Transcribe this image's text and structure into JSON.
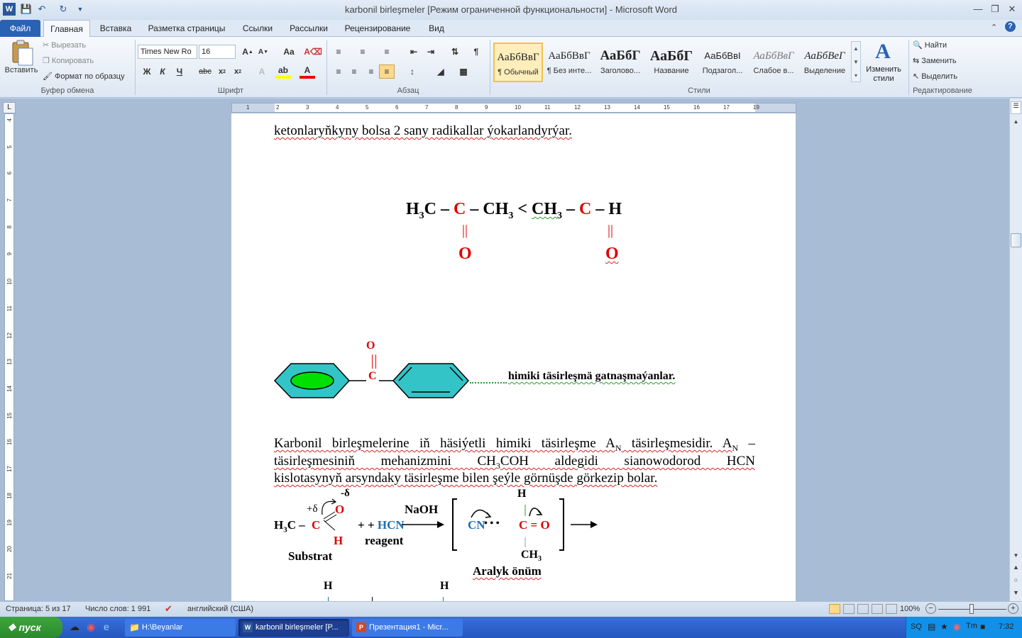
{
  "window": {
    "title": "karbonil birleşmeler [Режим ограниченной функциональности]  -  Microsoft Word",
    "qat": [
      "save-icon",
      "undo-icon",
      "redo-icon",
      "customize-icon"
    ]
  },
  "tabs": [
    "Файл",
    "Главная",
    "Вставка",
    "Разметка страницы",
    "Ссылки",
    "Рассылки",
    "Рецензирование",
    "Вид"
  ],
  "clipboard": {
    "paste": "Вставить",
    "cut": "Вырезать",
    "copy": "Копировать",
    "format_painter": "Формат по образцу",
    "label": "Буфер обмена"
  },
  "font": {
    "name": "Times New Ro",
    "size": "16",
    "label": "Шрифт",
    "bold": "Ж",
    "italic": "К",
    "underline": "Ч",
    "strike": "abc"
  },
  "paragraph": {
    "label": "Абзац"
  },
  "styles": {
    "label": "Стили",
    "items": [
      {
        "sample": "АаБбВвГ",
        "name": "¶ Обычный"
      },
      {
        "sample": "АаБбВвГ",
        "name": "¶ Без инте..."
      },
      {
        "sample": "АаБбГ",
        "name": "Заголово..."
      },
      {
        "sample": "АаБбГ",
        "name": "Название"
      },
      {
        "sample": "АаБбВвІ",
        "name": "Подзагол..."
      },
      {
        "sample": "АаБбВвГ",
        "name": "Слабое в..."
      },
      {
        "sample": "АаБбВеГ",
        "name": "Выделение"
      }
    ],
    "change": "Изменить стили"
  },
  "editing": {
    "find": "Найти",
    "replace": "Заменить",
    "select": "Выделить",
    "label": "Редактирование"
  },
  "ruler": [
    "1",
    "2",
    "3",
    "4",
    "5",
    "6",
    "7",
    "8",
    "9",
    "10",
    "11",
    "12",
    "13",
    "14",
    "15",
    "16",
    "17",
    "19"
  ],
  "vruler": [
    "4",
    "5",
    "6",
    "7",
    "8",
    "9",
    "10",
    "11",
    "12",
    "13",
    "14",
    "15",
    "16",
    "17",
    "18",
    "19",
    "20",
    "21"
  ],
  "doc": {
    "line1": "ketonlaryňkyny bolsa 2 sany radikallar ýokarlandyrýar.",
    "f1": {
      "h3c": "H",
      "three": "3",
      "c": "C",
      "dash": "–",
      "cred": "C",
      "ch3": "– CH",
      "lt": "<",
      "ch3b": "CH",
      "cred2": "C",
      "h": "– H",
      "o": "O",
      "bond": "||"
    },
    "o_top": "O",
    "c_mid": "C",
    "benz_caption": "himiki täsirleşmä gatnaşmaýanlar.",
    "para1": "Karbonil birleşmelerine iň häsiýetli himiki täsirleşme A",
    "para1b": " täsirleşmesidir. A",
    "para1c": " –",
    "sub_n": "N",
    "para2": "täsirleşmesiniň mehanizmini CH",
    "para2b": "COH aldegidi sianowodorod HCN",
    "para3": "kislotasynyň arsyndaky täsirleşme bilen şeýle görnüşde görkezip bolar.",
    "mech": {
      "neg_delta": "-δ",
      "pos_delta": "+δ",
      "o": "O",
      "h3c": "H",
      "c": "C",
      "h": "H",
      "plus_hcn": "+ ",
      "hcn": "HCN",
      "naoh": "NaOH",
      "reagent": "reagent",
      "substrat": "Substrat",
      "cn": "CN",
      "dots": "• • •",
      "co": "C = O",
      "htop": "H",
      "ch3": "CH",
      "inter": "Aralyk önüm"
    },
    "h_left": "H",
    "h_right": "H"
  },
  "status": {
    "page": "Страница: 5 из 17",
    "words": "Число слов: 1 991",
    "lang": "английский (США)",
    "zoom": "100%"
  },
  "taskbar": {
    "start": "пуск",
    "items": [
      "H:\\Beyanlar",
      "karbonil birleşmeler [P...",
      "Презентация1 - Micr..."
    ],
    "clock": "7:32",
    "tray": "SQ"
  },
  "colors": {
    "accent": "#2a62b3",
    "red": "#e00000",
    "teal": "#33c4c8",
    "green": "#00e000"
  }
}
